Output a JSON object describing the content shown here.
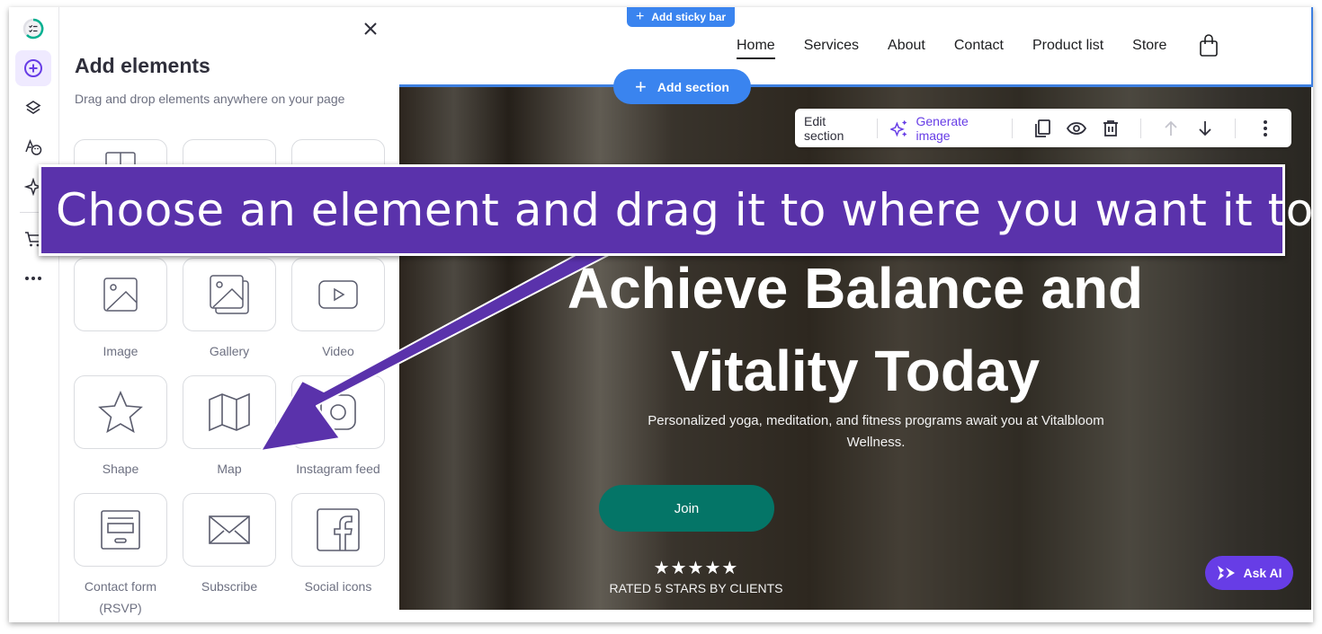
{
  "rail": {
    "items": [
      {
        "name": "checklist-progress",
        "icon": "checklist-icon"
      },
      {
        "name": "add-elements",
        "icon": "plus-circle-icon",
        "active": true
      },
      {
        "name": "layers",
        "icon": "layers-icon"
      },
      {
        "name": "styles",
        "icon": "palette-icon"
      },
      {
        "name": "ai-tools",
        "icon": "sparkle-icon"
      },
      {
        "name": "store",
        "icon": "cart-icon"
      },
      {
        "name": "more",
        "icon": "more-horizontal-icon"
      }
    ]
  },
  "panel": {
    "title": "Add elements",
    "subtitle": "Drag and drop elements anywhere on your page",
    "tiles": [
      {
        "label": "",
        "icon": "layout-icon"
      },
      {
        "label": "",
        "icon": "blank-icon"
      },
      {
        "label": "",
        "icon": "blank-icon"
      },
      {
        "label": "Image",
        "icon": "image-icon"
      },
      {
        "label": "Gallery",
        "icon": "gallery-icon"
      },
      {
        "label": "Video",
        "icon": "video-icon"
      },
      {
        "label": "Shape",
        "icon": "star-icon"
      },
      {
        "label": "Map",
        "icon": "map-icon"
      },
      {
        "label": "Instagram feed",
        "icon": "instagram-icon"
      },
      {
        "label": "Contact form (RSVP)",
        "icon": "form-icon"
      },
      {
        "label": "Subscribe",
        "icon": "envelope-icon"
      },
      {
        "label": "Social icons",
        "icon": "facebook-icon"
      }
    ]
  },
  "site": {
    "sticky_bar_label": "Add sticky bar",
    "add_section_label": "Add section",
    "nav": [
      "Home",
      "Services",
      "About",
      "Contact",
      "Product list",
      "Store"
    ],
    "nav_active": "Home",
    "toolbar": {
      "edit_section": "Edit section",
      "generate_image": "Generate image"
    },
    "hero": {
      "title_line1": "Achieve Balance and",
      "title_line2": "Vitality Today",
      "subtitle": "Personalized yoga, meditation, and fitness programs await you at Vitalbloom Wellness.",
      "cta": "Join",
      "stars": "★★★★★",
      "rating_text": "RATED 5 STARS BY CLIENTS"
    },
    "ask_ai_label": "Ask AI"
  },
  "annotation": {
    "banner_text": "Choose an element and drag it to where you want it to be"
  },
  "colors": {
    "brand_purple": "#673de6",
    "annotation_purple": "#5a32ab",
    "editor_blue": "#3a84ef",
    "cta_green": "#047567"
  }
}
